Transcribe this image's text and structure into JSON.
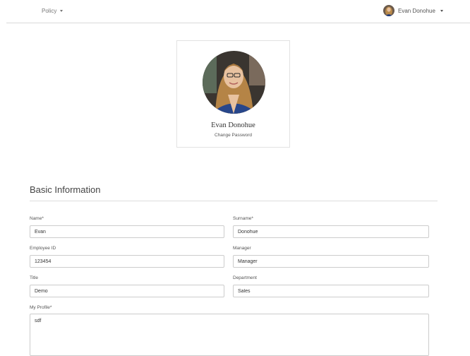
{
  "nav": {
    "policy_label": "Policy",
    "user_name": "Evan Donohue"
  },
  "profile": {
    "name": "Evan Donohue",
    "change_password_label": "Change Password"
  },
  "section": {
    "title": "Basic Information"
  },
  "form": {
    "name": {
      "label": "Name*",
      "value": "Evan"
    },
    "surname": {
      "label": "Surname*",
      "value": "Donohue"
    },
    "employee_id": {
      "label": "Employee ID",
      "value": "123454"
    },
    "manager": {
      "label": "Manager",
      "value": "Manager"
    },
    "title": {
      "label": "Title",
      "value": "Demo"
    },
    "department": {
      "label": "Department",
      "value": "Sales"
    },
    "my_profile": {
      "label": "My Profile*",
      "value": "sdf"
    }
  },
  "icons": {
    "policy_caret": "chevron-down-icon",
    "user_caret": "chevron-down-icon"
  },
  "colors": {
    "border": "#cccccc",
    "text": "#333333",
    "muted": "#777777"
  }
}
